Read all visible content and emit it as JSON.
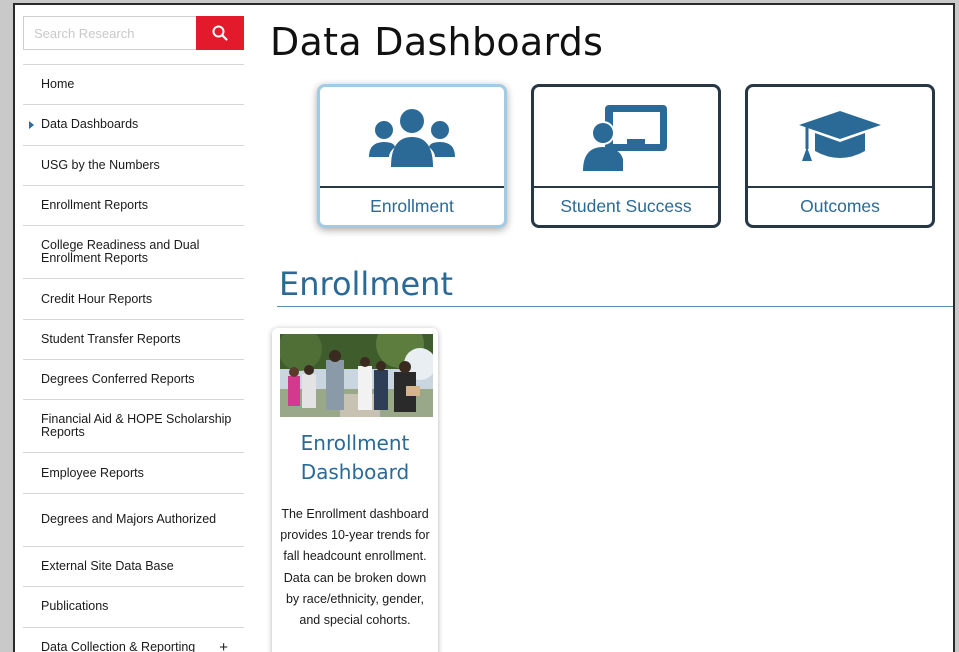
{
  "search": {
    "placeholder": "Search Research"
  },
  "nav": {
    "items": [
      {
        "label": "Home"
      },
      {
        "label": "Data Dashboards"
      },
      {
        "label": "USG by the Numbers"
      },
      {
        "label": "Enrollment Reports"
      },
      {
        "label": "College Readiness and Dual Enrollment Reports"
      },
      {
        "label": "Credit Hour Reports"
      },
      {
        "label": "Student Transfer Reports"
      },
      {
        "label": "Degrees Conferred Reports"
      },
      {
        "label": "Financial Aid & HOPE Scholarship Reports"
      },
      {
        "label": "Employee Reports"
      },
      {
        "label": "Degrees and Majors Authorized"
      },
      {
        "label": "External Site Data Base"
      },
      {
        "label": "Publications"
      },
      {
        "label": "Data Collection & Reporting",
        "toggle": "+"
      }
    ]
  },
  "main": {
    "title": "Data Dashboards",
    "tiles": [
      {
        "label": "Enrollment",
        "icon": "users-icon"
      },
      {
        "label": "Student Success",
        "icon": "presentation-icon"
      },
      {
        "label": "Outcomes",
        "icon": "graduation-cap-icon"
      }
    ],
    "section_title": "Enrollment",
    "card": {
      "title": "Enrollment Dashboard",
      "description": "The Enrollment dashboard provides 10-year trends for fall headcount enrollment. Data can be broken down by race/ethnicity, gender, and special cohorts."
    }
  },
  "colors": {
    "accent_red": "#e21a2c",
    "brand_blue": "#2b6a96",
    "tile_border": "#263746",
    "active_tile_border": "#9fcbe3"
  }
}
